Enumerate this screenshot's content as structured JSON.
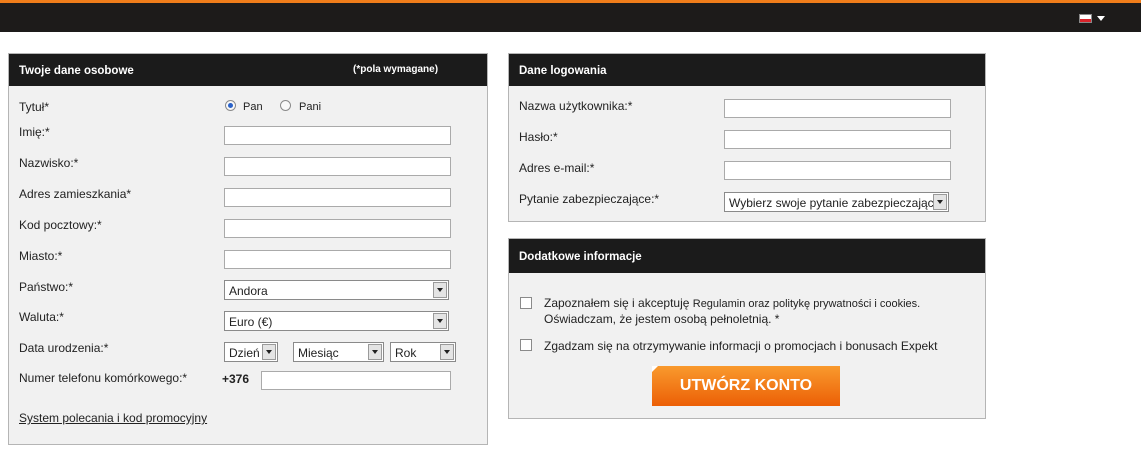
{
  "topbar": {
    "language_flag": "poland-flag-icon"
  },
  "personal": {
    "title": "Twoje dane osobowe",
    "required_note": "(*pola wymagane)",
    "tytul_label": "Tytuł*",
    "radio_pan": "Pan",
    "radio_pani": "Pani",
    "imie_label": "Imię:*",
    "nazwisko_label": "Nazwisko:*",
    "adres_label": "Adres zamieszkania*",
    "kod_label": "Kod pocztowy:*",
    "miasto_label": "Miasto:*",
    "panstwo_label": "Państwo:*",
    "panstwo_value": "Andora",
    "waluta_label": "Waluta:*",
    "waluta_value": "Euro (€)",
    "data_label": "Data urodzenia:*",
    "day_value": "Dzień",
    "month_value": "Miesiąc",
    "year_value": "Rok",
    "phone_label": "Numer telefonu komórkowego:*",
    "phone_prefix": "+376",
    "promo_link": "System polecania i kod promocyjny"
  },
  "login": {
    "title": "Dane logowania",
    "username_label": "Nazwa użytkownika:*",
    "password_label": "Hasło:*",
    "email_label": "Adres e-mail:*",
    "question_label": "Pytanie zabezpieczające:*",
    "question_value": "Wybierz swoje pytanie zabezpieczające"
  },
  "extra": {
    "title": "Dodatkowe informacje",
    "terms_part1": "Zapoznałem się i akceptuję ",
    "terms_link1": "Regulamin",
    "terms_part2": " oraz ",
    "terms_link2": "politykę prywatności i cookies",
    "terms_part3": ".",
    "terms_line2": "Oświadczam, że jestem osobą pełnoletnią. *",
    "promo_consent": "Zgadzam się na otrzymywanie informacji o promocjach i bonusach Expekt",
    "create_button": "UTWÓRZ KONTO"
  },
  "colors": {
    "accent": "#f07d1a",
    "header_bg": "#1b1b1b",
    "panel_bg": "#f1f1f1"
  }
}
